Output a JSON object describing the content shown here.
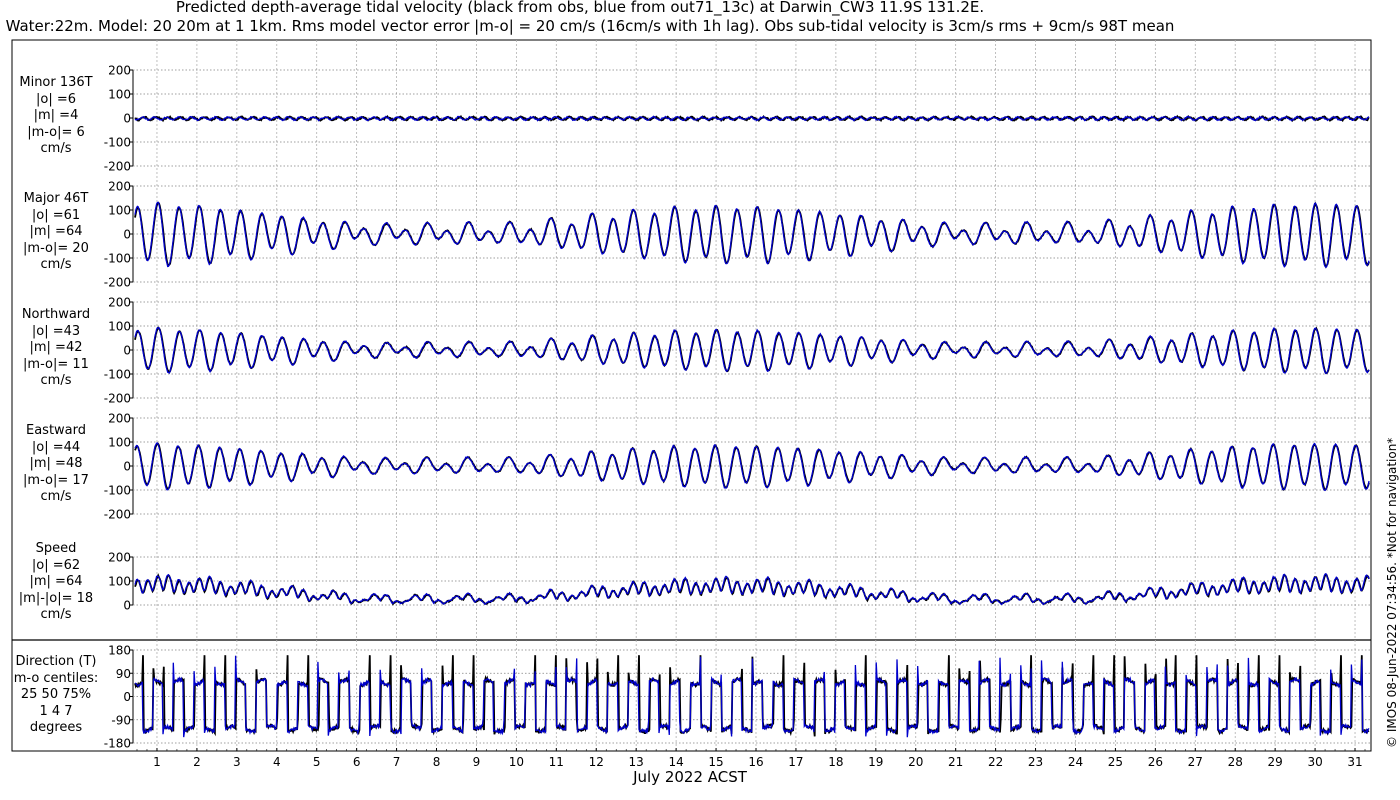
{
  "header": {
    "title_line1": "Predicted depth-average tidal velocity (black from obs, blue from out71_13c) at Darwin_CW3 11.9S 131.2E.",
    "title_line2": "Water:22m. Model: 20 20m at 1 1km. Rms model vector error |m-o| = 20 cm/s (16cm/s with 1h lag). Obs sub-tidal velocity is 3cm/s rms + 9cm/s 98T mean"
  },
  "footer": {
    "xlabel": "July 2022 ACST",
    "copyright": "© IMOS 08-Jun-2022 07:34:56. *Not for navigation*"
  },
  "panels": [
    {
      "lines": [
        "Minor 136T",
        "|o| =6",
        "|m| =4",
        "|m-o|= 6",
        "cm/s"
      ]
    },
    {
      "lines": [
        "Major 46T",
        "|o| =61",
        "|m| =64",
        "|m-o|= 20",
        "cm/s"
      ]
    },
    {
      "lines": [
        "Northward",
        "|o| =43",
        "|m| =42",
        "|m-o|= 11",
        "cm/s"
      ]
    },
    {
      "lines": [
        "Eastward",
        "|o| =44",
        "|m| =48",
        "|m-o|= 17",
        "cm/s"
      ]
    },
    {
      "lines": [
        "Speed",
        "|o| =62",
        "|m| =64",
        "|m|-|o|= 18",
        "cm/s"
      ]
    },
    {
      "lines": [
        "Direction (T)",
        "m-o centiles:",
        "25  50  75%",
        "1   4   7",
        "degrees"
      ]
    }
  ],
  "chart_data": {
    "type": "line",
    "series": [
      {
        "name": "obs",
        "color": "#000000"
      },
      {
        "name": "out71_13c",
        "color": "#0000cc"
      }
    ],
    "x_range_days": [
      0.4,
      31.4
    ],
    "x_ticks": [
      "1",
      "2",
      "3",
      "4",
      "5",
      "6",
      "7",
      "8",
      "9",
      "10",
      "11",
      "12",
      "13",
      "14",
      "15",
      "16",
      "17",
      "18",
      "19",
      "20",
      "21",
      "22",
      "23",
      "24",
      "25",
      "26",
      "27",
      "28",
      "29",
      "30",
      "31"
    ],
    "subplots": [
      {
        "name": "minor",
        "ylim": [
          -200,
          200
        ],
        "yticks": [
          "200",
          "100",
          "0",
          "-100",
          "-200"
        ],
        "amplitude_cm_s": 6
      },
      {
        "name": "major",
        "ylim": [
          -200,
          200
        ],
        "yticks": [
          "200",
          "100",
          "0",
          "-100",
          "-200"
        ],
        "amplitude_cm_s": 120
      },
      {
        "name": "northward",
        "ylim": [
          -200,
          200
        ],
        "yticks": [
          "200",
          "100",
          "0",
          "-100",
          "-200"
        ],
        "amplitude_cm_s": 85
      },
      {
        "name": "eastward",
        "ylim": [
          -200,
          200
        ],
        "yticks": [
          "200",
          "100",
          "0",
          "-100",
          "-200"
        ],
        "amplitude_cm_s": 88
      },
      {
        "name": "speed",
        "ylim": [
          0,
          200
        ],
        "yticks": [
          "200",
          "100",
          "0"
        ],
        "amplitude_cm_s": 125
      },
      {
        "name": "direction",
        "ylim": [
          -180,
          180
        ],
        "yticks": [
          "180",
          "90",
          "0",
          "-90",
          "-180"
        ]
      }
    ]
  }
}
